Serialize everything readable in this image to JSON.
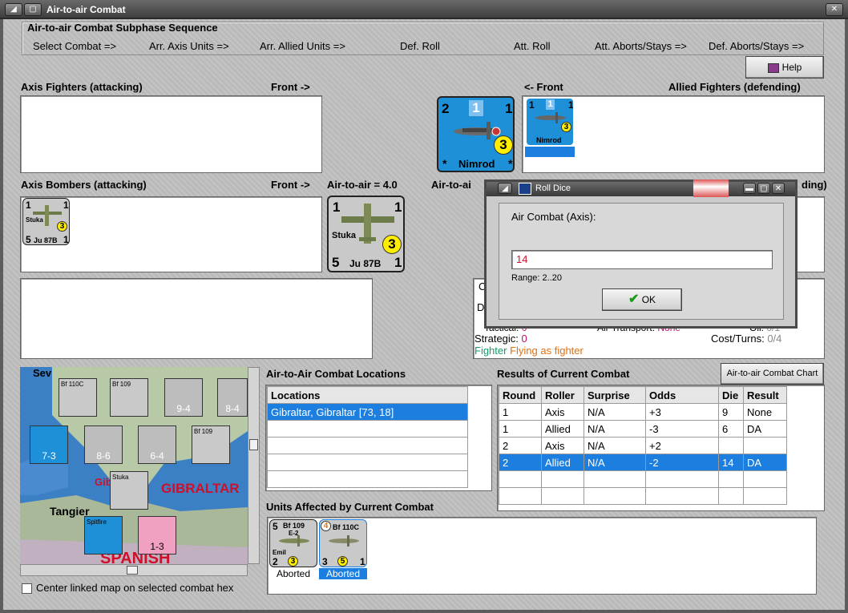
{
  "window": {
    "title": "Air-to-air Combat"
  },
  "sequence": {
    "title": "Air-to-air Combat Subphase Sequence",
    "steps": [
      "Select Combat =>",
      "Arr. Axis Units =>",
      "Arr. Allied Units =>",
      "Def. Roll",
      "Att. Roll",
      "Att. Aborts/Stays =>",
      "Def. Aborts/Stays =>"
    ]
  },
  "help": {
    "label": "Help"
  },
  "axis_fighters": {
    "label": "Axis Fighters (attacking)",
    "front": "Front ->"
  },
  "allied_fighters": {
    "label": "Allied Fighters (defending)",
    "front": "<- Front"
  },
  "nimrod_big": {
    "attack": "2",
    "air": "1",
    "def": "1",
    "range": "3",
    "name": "Nimrod"
  },
  "nimrod_small": {
    "attack": "1",
    "air": "1",
    "def": "1",
    "range": "3",
    "name": "Nimrod"
  },
  "axis_bombers": {
    "label": "Axis Bombers (attacking)",
    "front": "Front ->"
  },
  "air_to_air": {
    "label": "Air-to-air = 4.0",
    "allied_cut": "Air-to-ai",
    "right_cut": "ding)"
  },
  "stuka_big": {
    "top_l": "1",
    "top_r": "1",
    "name_lbl": "Stuka",
    "range": "3",
    "bottom": "5",
    "model": "Ju 87B",
    "bottom_r": "1"
  },
  "stuka_small": {
    "top_l": "1",
    "top_r": "1",
    "name_lbl": "Stuka",
    "range": "3",
    "bottom": "5",
    "model": "Ju 87B",
    "bottom_r": "1"
  },
  "info": {
    "c": "C",
    "d": "D",
    "tactical": "Tactical:",
    "tactical_v": "0",
    "air_transport": "Air Transport:",
    "air_transport_v": "None",
    "oil": "Oil:",
    "oil_v": "0/1",
    "strategic": "Strategic:",
    "strategic_v": "0",
    "cost": "Cost/Turns:",
    "cost_v": "0/4",
    "fighter": "Fighter",
    "flying": "Flying as fighter"
  },
  "dialog": {
    "title": "Roll Dice",
    "prompt": "Air Combat (Axis):",
    "value": "14",
    "range": "Range: 2..20",
    "ok": "OK"
  },
  "locations": {
    "label": "Air-to-Air Combat Locations",
    "header": "Locations",
    "items": [
      "Gibraltar, Gibraltar [73, 18]"
    ]
  },
  "results": {
    "label": "Results of Current Combat",
    "chart_button": "Air-to-air Combat Chart",
    "headers": [
      "Round",
      "Roller",
      "Surprise",
      "Odds",
      "Die",
      "Result"
    ],
    "rows": [
      [
        "1",
        "Axis",
        "N/A",
        "+3",
        "9",
        "None"
      ],
      [
        "1",
        "Allied",
        "N/A",
        "-3",
        "6",
        "DA"
      ],
      [
        "2",
        "Axis",
        "N/A",
        "+2",
        "",
        ""
      ],
      [
        "2",
        "Allied",
        "N/A",
        "-2",
        "14",
        "DA"
      ]
    ]
  },
  "affected": {
    "label": "Units Affected by Current Combat",
    "units": [
      {
        "top": "5",
        "name": "Bf 109",
        "sub": "E-2",
        "nick": "Emil",
        "bl": "2",
        "range": "3",
        "status": "Aborted"
      },
      {
        "top": "4",
        "name": "Bf 110C",
        "sub": "",
        "nick": "",
        "bl": "3",
        "range": "5",
        "br": "1",
        "status": "Aborted"
      }
    ]
  },
  "map": {
    "labels": {
      "gibraltar": "GIBRALTAR",
      "gib": "Gibr",
      "tangier": "Tangier",
      "spanish": "SPANISH",
      "sev": "Sev"
    },
    "counters": [
      "Bf 110C",
      "Bf 109",
      "9-4",
      "8-4",
      "7-3",
      "8-6",
      "6-4",
      "Bf 109",
      "Stuka",
      "Spitfire",
      "1-3"
    ]
  },
  "center_linked": {
    "label": "Center linked map on selected combat hex"
  },
  "colors": {
    "selection": "#1c7fe0",
    "allied_counter": "#1e90d8",
    "axis_counter": "#c9c9c9",
    "highlight_red": "#d0102a"
  }
}
